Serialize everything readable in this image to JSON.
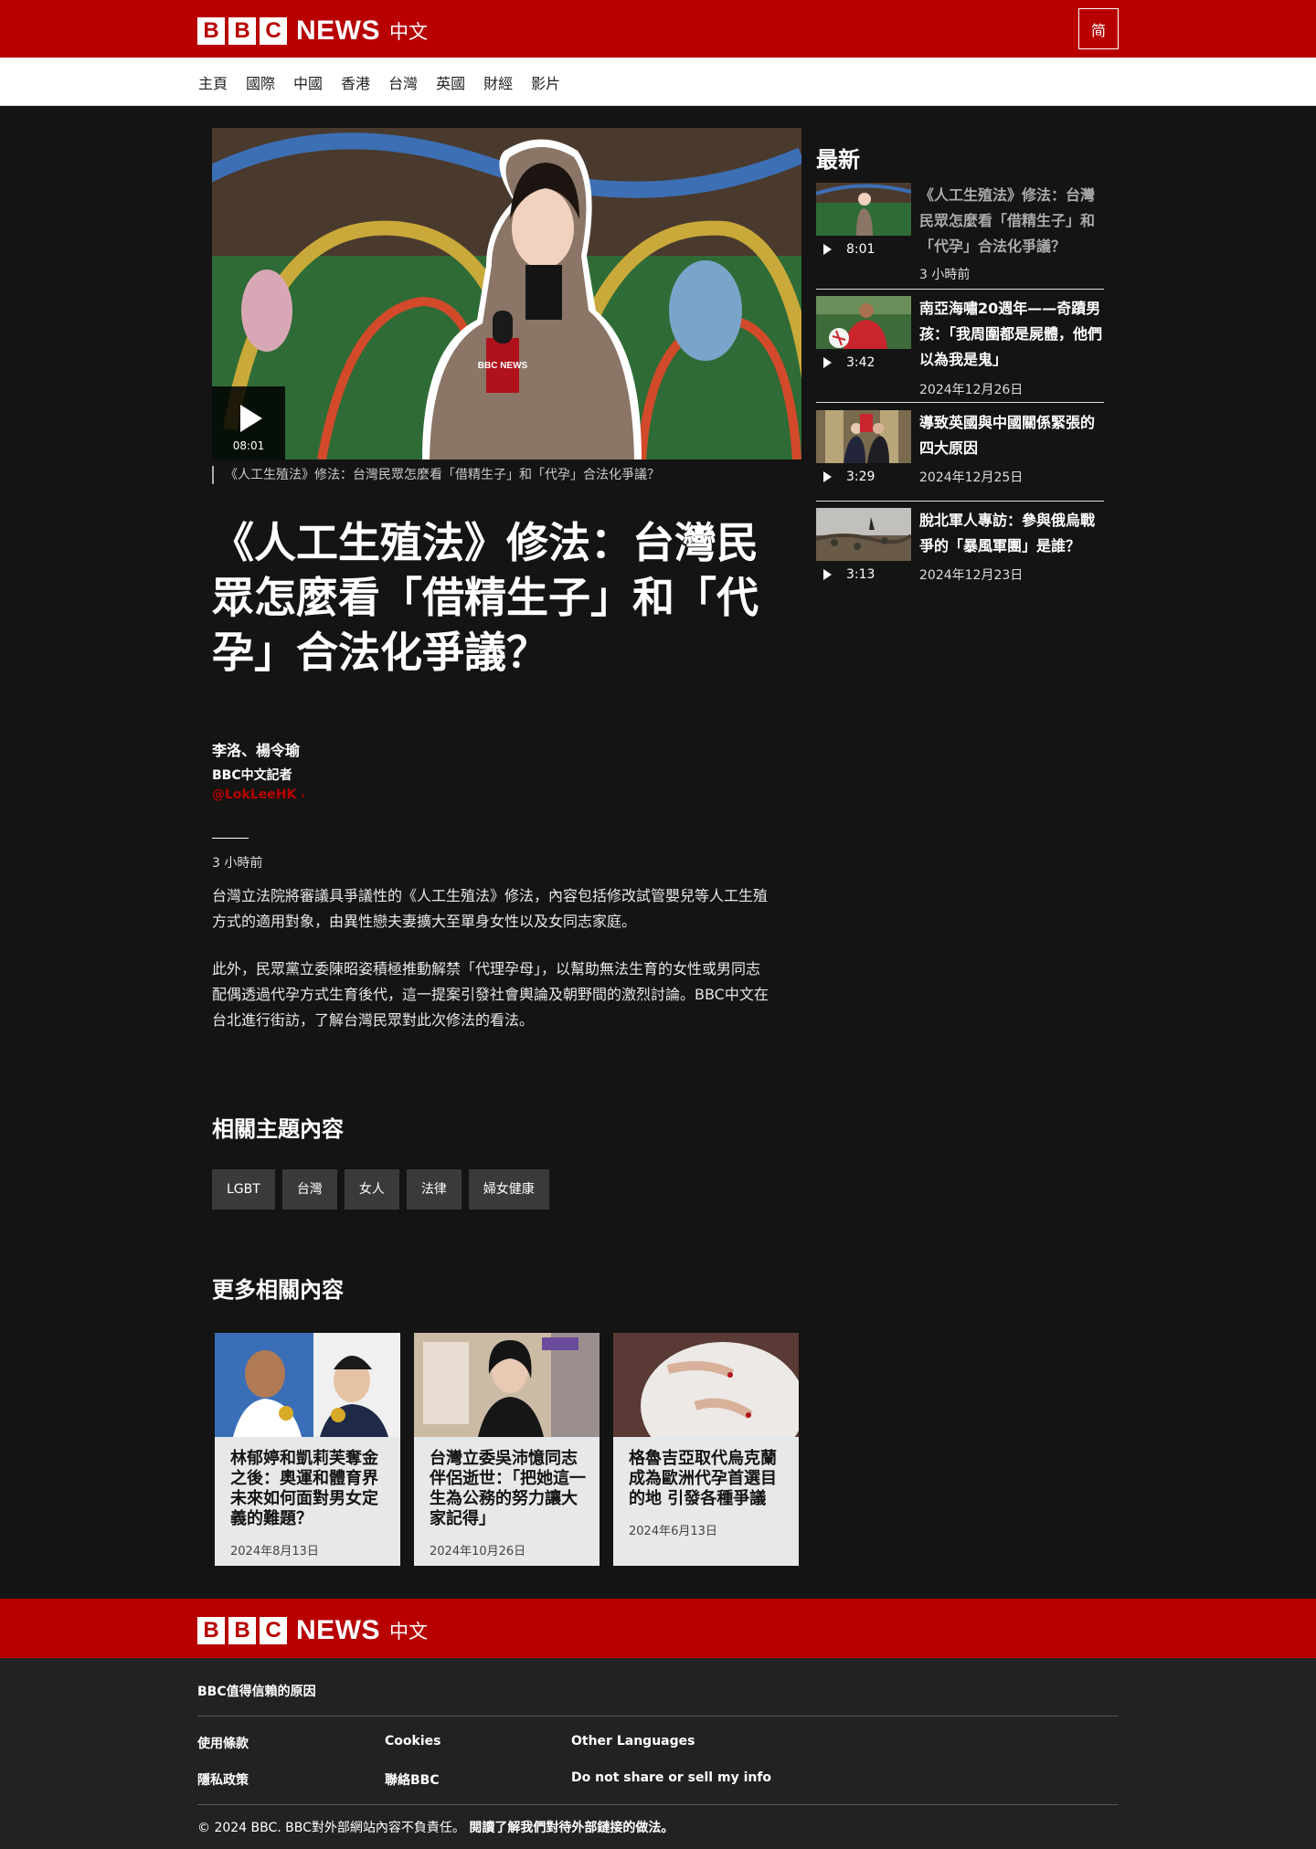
{
  "header": {
    "logo_letters": [
      "B",
      "B",
      "C"
    ],
    "logo_news": "NEWS",
    "logo_lang": "中文",
    "script_toggle": "简"
  },
  "nav": [
    "主頁",
    "國際",
    "中國",
    "香港",
    "台灣",
    "英國",
    "財經",
    "影片"
  ],
  "video": {
    "duration": "08:01",
    "caption": "《人工生殖法》修法：台灣民眾怎麼看「借精生子」和「代孕」合法化爭議？",
    "mic_logo": "BBC NEWS"
  },
  "article": {
    "headline": "《人工生殖法》修法：台灣民眾怎麼看「借精生子」和「代孕」合法化爭議？",
    "author": "李洛、楊令瑜",
    "author_role": "BBC中文記者",
    "author_handle": "@LokLeeHK",
    "timestamp": "3 小時前",
    "paragraphs": [
      "台灣立法院將審議具爭議性的《人工生殖法》修法，內容包括修改試管嬰兒等人工生殖方式的適用對象，由異性戀夫妻擴大至單身女性以及女同志家庭。",
      "此外，民眾黨立委陳昭姿積極推動解禁「代理孕母」，以幫助無法生育的女性或男同志配偶透過代孕方式生育後代，這一提案引發社會輿論及朝野間的激烈討論。BBC中文在台北進行街訪，了解台灣民眾對此次修法的看法。"
    ]
  },
  "related_topics": {
    "title": "相關主題內容",
    "tags": [
      "LGBT",
      "台灣",
      "女人",
      "法律",
      "婦女健康"
    ]
  },
  "more_related": {
    "title": "更多相關內容",
    "cards": [
      {
        "title": "林郁婷和凱莉芙奪金之後：奧運和體育界未來如何面對男女定義的難題？",
        "date": "2024年8月13日"
      },
      {
        "title": "台灣立委吳沛憶同志伴侶逝世：「把她這一生為公務的努力讓大家記得」",
        "date": "2024年10月26日"
      },
      {
        "title": "格魯吉亞取代烏克蘭成為歐洲代孕首選目的地 引發各種爭議",
        "date": "2024年6月13日"
      }
    ]
  },
  "latest": {
    "title": "最新",
    "items": [
      {
        "title": "《人工生殖法》修法：台灣民眾怎麼看「借精生子」和「代孕」合法化爭議？",
        "duration": "8:01",
        "date": "3 小時前"
      },
      {
        "title": "南亞海嘯20週年——奇蹟男孩：「我周圍都是屍體，他們以為我是鬼」",
        "duration": "3:42",
        "date": "2024年12月26日"
      },
      {
        "title": "導致英國與中國關係緊張的四大原因",
        "duration": "3:29",
        "date": "2024年12月25日"
      },
      {
        "title": "脫北軍人專訪：參與俄烏戰爭的「暴風軍團」是誰？",
        "duration": "3:13",
        "date": "2024年12月23日"
      }
    ]
  },
  "footer": {
    "trust": "BBC值得信賴的原因",
    "links": [
      "使用條款",
      "Cookies",
      "Other Languages",
      "隱私政策",
      "聯絡BBC",
      "Do not share or sell my info"
    ],
    "copyright": "© 2024 BBC. BBC對外部網站內容不負責任。",
    "external_link": "閱讀了解我們對待外部鏈接的做法。"
  },
  "colors": {
    "brand_red": "#b80000",
    "page_bg": "#141414",
    "footer_bg": "#222222"
  }
}
